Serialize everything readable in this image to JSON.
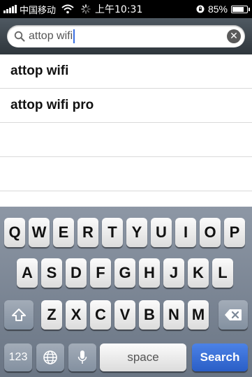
{
  "status_bar": {
    "carrier": "中国移动",
    "time": "上午10:31",
    "battery": "85%"
  },
  "search": {
    "query": "attop wifi",
    "clear_icon": "clear-x-icon"
  },
  "suggestions": [
    {
      "label": "attop wifi"
    },
    {
      "label": "attop wifi pro"
    }
  ],
  "keyboard": {
    "row1": [
      "Q",
      "W",
      "E",
      "R",
      "T",
      "Y",
      "U",
      "I",
      "O",
      "P"
    ],
    "row2": [
      "A",
      "S",
      "D",
      "F",
      "G",
      "H",
      "J",
      "K",
      "L"
    ],
    "row3": [
      "Z",
      "X",
      "C",
      "V",
      "B",
      "N",
      "M"
    ],
    "numbers_label": "123",
    "space_label": "space",
    "search_label": "Search"
  },
  "colors": {
    "search_key": "#3a6fd8",
    "keyboard_bg": "#7a8594",
    "status_bg": "#000000"
  }
}
